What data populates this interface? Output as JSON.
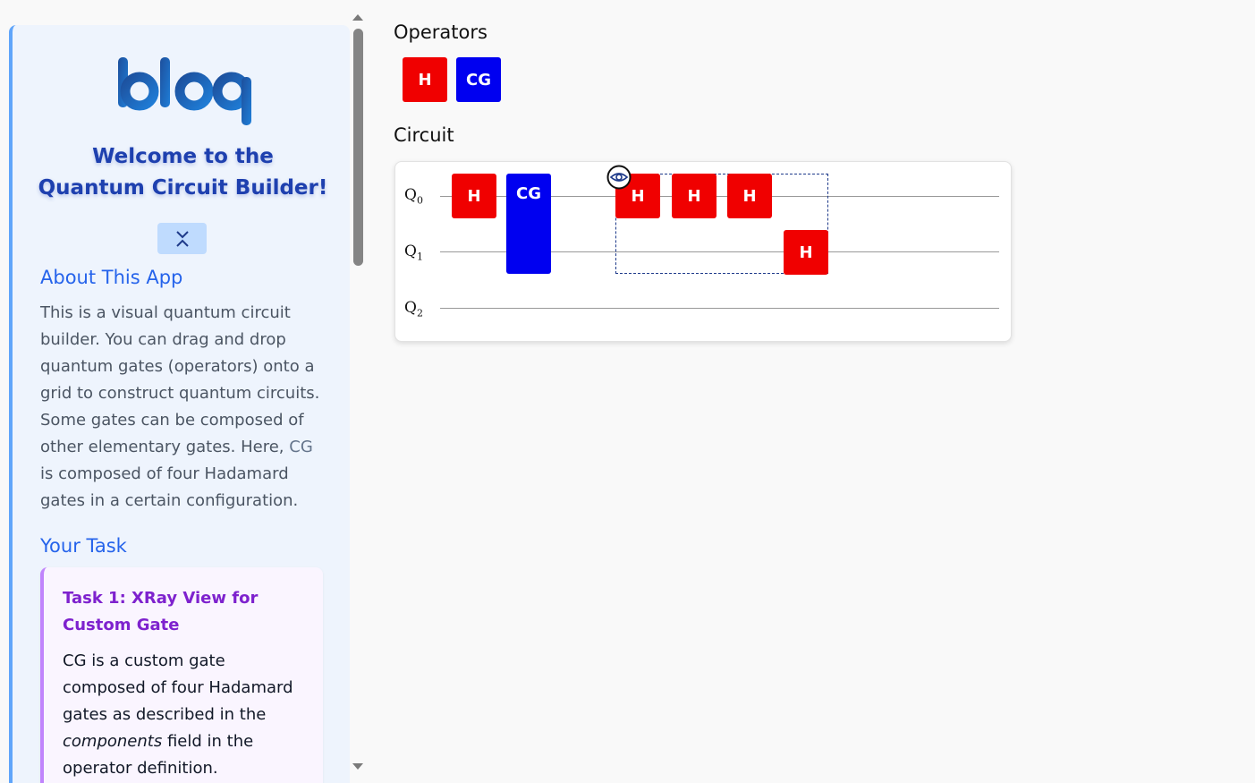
{
  "sidebar": {
    "logo_text": "bloq",
    "welcome_line1": "Welcome to the",
    "welcome_line2": "Quantum Circuit Builder!",
    "about_title": "About This App",
    "about_text_1": "This is a visual quantum circuit builder. You can drag and drop quantum gates (operators) onto a grid to construct quantum circuits. Some gates can be composed of other elementary gates. Here, ",
    "about_gate_name": "CG",
    "about_text_2": " is composed of four Hadamard gates in a certain configuration.",
    "task_section_title": "Your Task",
    "task_title": "Task 1: XRay View for Custom Gate",
    "task_text_1": "CG is a custom gate composed of four Hadamard gates as described in the ",
    "task_text_em": "components",
    "task_text_2": " field in the operator definition."
  },
  "main": {
    "operators_heading": "Operators",
    "circuit_heading": "Circuit",
    "operators": [
      {
        "label": "H",
        "color": "#f00000"
      },
      {
        "label": "CG",
        "color": "#0000f0"
      }
    ],
    "qubits": [
      {
        "name": "Q",
        "index": "0"
      },
      {
        "name": "Q",
        "index": "1"
      },
      {
        "name": "Q",
        "index": "2"
      }
    ],
    "placed_gates": [
      {
        "label": "H",
        "qubit": 0
      },
      {
        "label": "CG",
        "qubits": [
          0,
          1
        ]
      },
      {
        "label": "H",
        "qubit": 0,
        "xray": true
      },
      {
        "label": "H",
        "qubit": 0,
        "xray": true
      },
      {
        "label": "H",
        "qubit": 0,
        "xray": true
      },
      {
        "label": "H",
        "qubit": 1,
        "xray": true
      }
    ]
  },
  "icons": {
    "collapse": "chevrons-collapse-icon",
    "xray": "eye-icon"
  }
}
